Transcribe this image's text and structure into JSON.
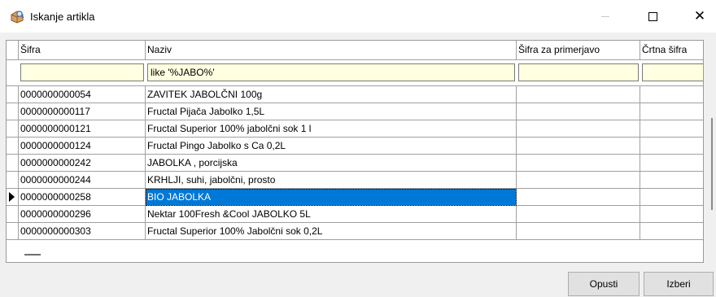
{
  "window": {
    "title": "Iskanje artikla",
    "close_glyph": "✕",
    "icons": [
      "search-box-icon",
      "minimize-icon",
      "maximize-icon",
      "close-icon"
    ]
  },
  "grid": {
    "columns": [
      {
        "label": "Šifra"
      },
      {
        "label": "Naziv"
      },
      {
        "label": "Šifra za primerjavo"
      },
      {
        "label": "Črtna šifra"
      }
    ],
    "filters": [
      "",
      "like '%JABO%'",
      "",
      ""
    ],
    "rows": [
      {
        "sifra": "0000000000054",
        "naziv": "ZAVITEK JABOLČNI 100g",
        "primerjava": "",
        "crtna": ""
      },
      {
        "sifra": "0000000000117",
        "naziv": "Fructal Pijača Jabolko 1,5L",
        "primerjava": "",
        "crtna": ""
      },
      {
        "sifra": "0000000000121",
        "naziv": "Fructal Superior 100% jabolčni sok 1 l",
        "primerjava": "",
        "crtna": ""
      },
      {
        "sifra": "0000000000124",
        "naziv": "Fructal Pingo Jabolko s Ca 0,2L",
        "primerjava": "",
        "crtna": ""
      },
      {
        "sifra": "0000000000242",
        "naziv": "JABOLKA , porcijska",
        "primerjava": "",
        "crtna": ""
      },
      {
        "sifra": "0000000000244",
        "naziv": "KRHLJI, suhi, jabolčni, prosto",
        "primerjava": "",
        "crtna": ""
      },
      {
        "sifra": "0000000000258",
        "naziv": "BIO JABOLKA",
        "primerjava": "",
        "crtna": "",
        "selected": true
      },
      {
        "sifra": "0000000000296",
        "naziv": "Nektar 100Fresh &Cool JABOLKO 5L",
        "primerjava": "",
        "crtna": ""
      },
      {
        "sifra": "0000000000303",
        "naziv": "Fructal Superior 100% Jabolčni sok 0,2L",
        "primerjava": "",
        "crtna": ""
      }
    ],
    "selection_color": "#0078d7",
    "filter_bg": "#ffffe1"
  },
  "buttons": {
    "cancel": "Opusti",
    "select": "Izberi"
  }
}
